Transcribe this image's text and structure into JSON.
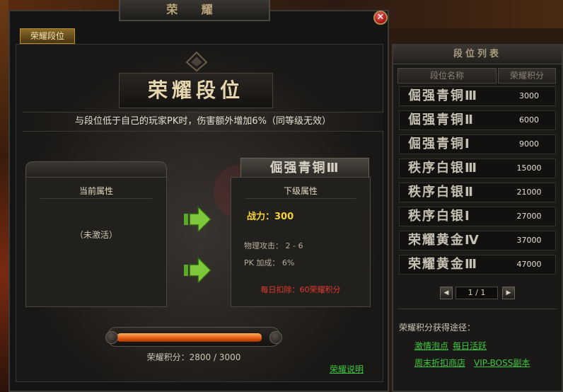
{
  "window": {
    "title": "荣 耀",
    "close_symbol": "✕",
    "tab_label": "荣耀段位",
    "rank_heading": "荣耀段位",
    "description": "与段位低于自己的玩家PK时，伤害额外增加6%（同等级无效）"
  },
  "current": {
    "title": "当前属性",
    "inactive_text": "（未激活）"
  },
  "next": {
    "rank_name": "倔强青铜Ⅲ",
    "title": "下级属性",
    "power": "战力：300",
    "attack": "物理攻击：  2  -  6",
    "pk_bonus": "PK  加成：  6%",
    "daily_deduct": "每日扣除：60荣耀积分"
  },
  "progress": {
    "current": 2800,
    "max": 3000,
    "label": "荣耀积分：2800  /  3000",
    "explain_link": "荣耀说明"
  },
  "rank_list": {
    "title": "段位列表",
    "col_name": "段位名称",
    "col_points": "荣耀积分",
    "rows": [
      {
        "name": "倔强青铜Ⅲ",
        "points": "3000"
      },
      {
        "name": "倔强青铜Ⅱ",
        "points": "6000"
      },
      {
        "name": "倔强青铜Ⅰ",
        "points": "9000"
      },
      {
        "name": "秩序白银Ⅲ",
        "points": "15000"
      },
      {
        "name": "秩序白银Ⅱ",
        "points": "21000"
      },
      {
        "name": "秩序白银Ⅰ",
        "points": "27000"
      },
      {
        "name": "荣耀黄金Ⅳ",
        "points": "37000"
      },
      {
        "name": "荣耀黄金Ⅲ",
        "points": "47000"
      }
    ],
    "page": "1 / 1",
    "prev_symbol": "◀",
    "next_symbol": "▶",
    "ways_title": "荣耀积分获得途径：",
    "links": [
      "激情泡点",
      "每日活跃",
      "周末折扣商店",
      "VIP-BOSS副本"
    ]
  },
  "colors": {
    "accent_gold": "#f6d23a",
    "link_green": "#3ec83e",
    "warn_red": "#e23a2a",
    "bar_orange": "#e05a10"
  }
}
